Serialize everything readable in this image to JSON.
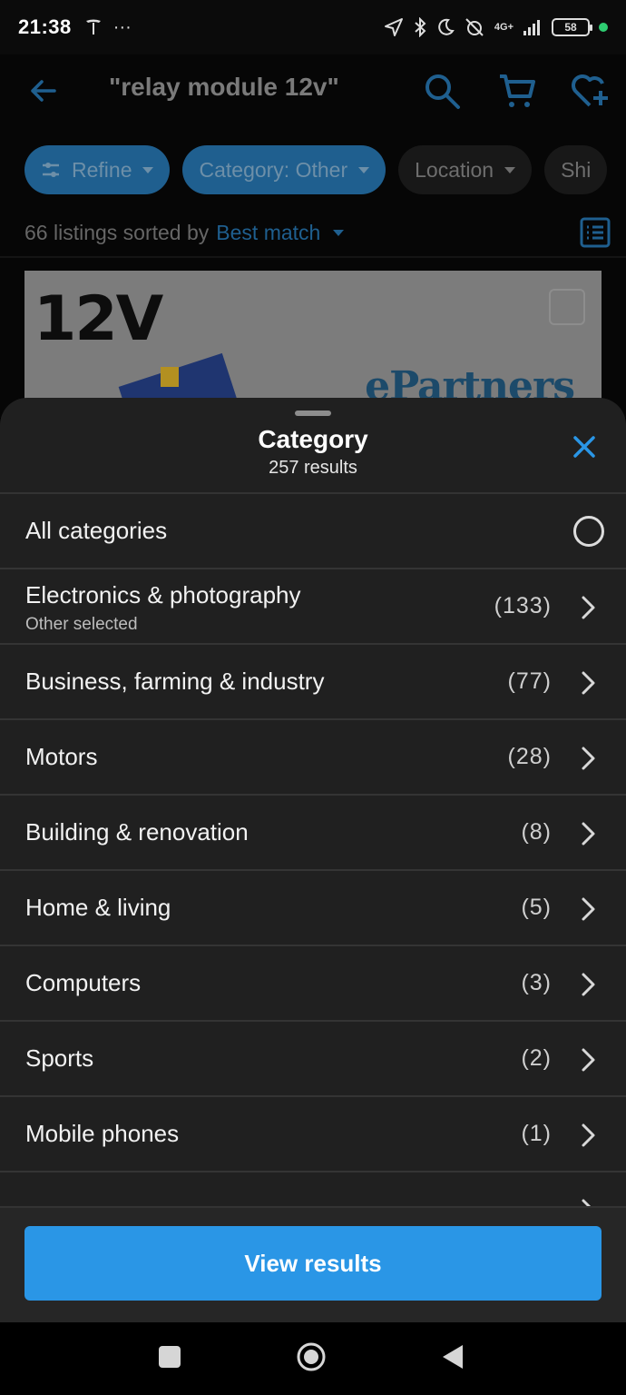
{
  "status_bar": {
    "time": "21:38",
    "dots": "···",
    "network": "4G+",
    "battery": "58"
  },
  "header": {
    "search_query": "\"relay module 12v\""
  },
  "filter_chips": [
    {
      "label": "Refine"
    },
    {
      "label": "Category: Other"
    },
    {
      "label": "Location"
    },
    {
      "label": "Shi"
    }
  ],
  "listing_bar": {
    "count_text": "66 listings sorted by",
    "sort_label": "Best match"
  },
  "listing_thumbnail": {
    "big_text": "12V",
    "brand_text": "ePartners"
  },
  "sheet": {
    "title": "Category",
    "subtitle": "257 results",
    "all_label": "All categories",
    "categories": [
      {
        "name": "Electronics & photography",
        "note": "Other selected",
        "count": "(133)"
      },
      {
        "name": "Business, farming & industry",
        "count": "(77)"
      },
      {
        "name": "Motors",
        "count": "(28)"
      },
      {
        "name": "Building & renovation",
        "count": "(8)"
      },
      {
        "name": "Home & living",
        "count": "(5)"
      },
      {
        "name": "Computers",
        "count": "(3)"
      },
      {
        "name": "Sports",
        "count": "(2)"
      },
      {
        "name": "Mobile phones",
        "count": "(1)"
      }
    ],
    "view_button": "View results"
  },
  "colors": {
    "accent": "#2a96e6",
    "sheet_bg": "#202020",
    "chip_active": "#1f5f8f"
  }
}
